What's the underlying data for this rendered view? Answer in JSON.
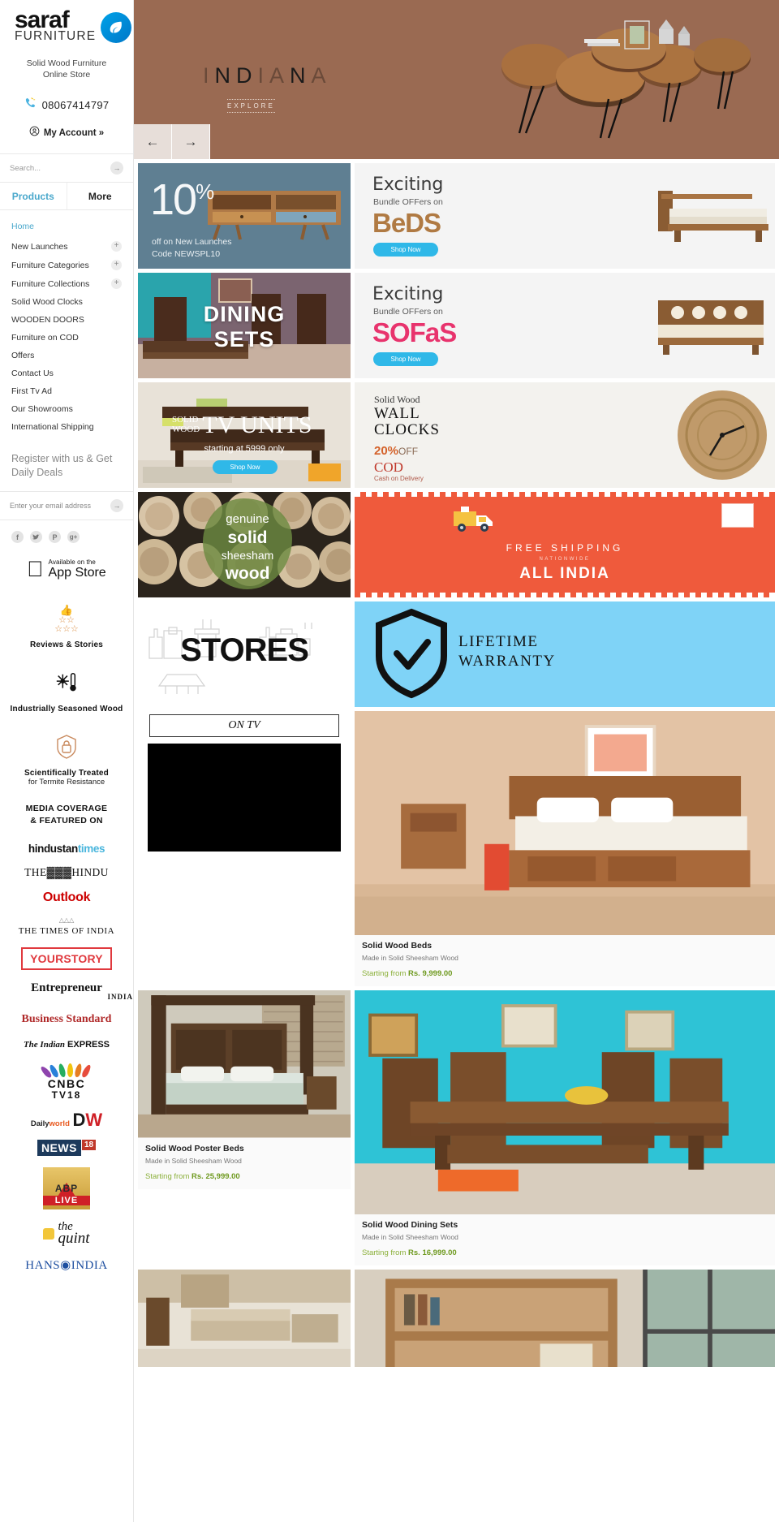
{
  "brand": {
    "name_line1": "saraf",
    "name_line2": "FURNITURE",
    "tagline_line1": "Solid Wood Furniture",
    "tagline_line2": "Online Store",
    "phone": "08067414797",
    "account_label": "My Account »"
  },
  "search": {
    "placeholder": "Search...",
    "submit_icon": "arrow-right-icon"
  },
  "tabs": [
    {
      "label": "Products",
      "active": true
    },
    {
      "label": "More",
      "active": false
    }
  ],
  "nav": [
    {
      "label": "Home",
      "expandable": false,
      "active": true
    },
    {
      "label": "New Launches",
      "expandable": true
    },
    {
      "label": "Furniture Categories",
      "expandable": true
    },
    {
      "label": "Furniture Collections",
      "expandable": true
    },
    {
      "label": "Solid Wood Clocks",
      "expandable": false
    },
    {
      "label": "WOODEN DOORS",
      "expandable": false
    },
    {
      "label": "Furniture on COD",
      "expandable": false
    },
    {
      "label": "Offers",
      "expandable": false
    },
    {
      "label": "Contact Us",
      "expandable": false
    },
    {
      "label": "First Tv Ad",
      "expandable": false
    },
    {
      "label": "Our Showrooms",
      "expandable": false
    },
    {
      "label": "International Shipping",
      "expandable": false
    }
  ],
  "newsletter": {
    "heading": "Register with us & Get Daily Deals",
    "placeholder": "Enter your email address",
    "submit_icon": "arrow-right-icon"
  },
  "social": [
    {
      "name": "facebook-icon",
      "glyph": "f"
    },
    {
      "name": "twitter-icon",
      "glyph": "✒"
    },
    {
      "name": "pinterest-icon",
      "glyph": "P"
    },
    {
      "name": "googleplus-icon",
      "glyph": "g+"
    }
  ],
  "appstore": {
    "small": "Available on the",
    "big": "App Store"
  },
  "features": [
    {
      "icon": "stars-thumbsup-icon",
      "title": "Reviews & Stories",
      "sub": ""
    },
    {
      "icon": "snowflake-thermometer-icon",
      "title": "Industrially Seasoned Wood",
      "sub": ""
    },
    {
      "icon": "shield-lock-icon",
      "title": "Scientifically Treated",
      "sub": "for Termite Resistance"
    }
  ],
  "media": {
    "heading_line1": "MEDIA COVERAGE",
    "heading_line2": "& FEATURED ON",
    "logos": [
      "hindustantimes",
      "THE HINDU",
      "Outlook",
      "THE TIMES OF INDIA",
      "YOURSTORY",
      "Entrepreneur INDIA",
      "Business Standard",
      "The Indian EXPRESS",
      "CNBC TV18",
      "Dailyworld DW",
      "NEWS 18",
      "ABP LIVE",
      "the quint",
      "THE HANS INDIA"
    ]
  },
  "hero": {
    "title": "INDIANA",
    "cta": "EXPLORE",
    "prev_icon": "arrow-left-icon",
    "next_icon": "arrow-right-icon",
    "bg_color": "#9a6a52"
  },
  "promos": [
    {
      "name": "ten-percent-off",
      "number": "10",
      "percent": "%",
      "line1": "off on New Launches",
      "line2": "Code NEWSPL10"
    },
    {
      "name": "bundle-offers-beds",
      "exciting": "Exciting",
      "bundle": "Bundle OFFers on",
      "category": "BeDS",
      "button": "Shop Now"
    },
    {
      "name": "dining-sets",
      "line1": "DINING",
      "line2": "SETS"
    },
    {
      "name": "bundle-offers-sofas",
      "exciting": "Exciting",
      "bundle": "Bundle OFFers on",
      "category": "SOFaS",
      "button": "Shop Now"
    },
    {
      "name": "tv-units",
      "solid": "SOLID",
      "wood": "WOOD",
      "tv": "TV UNITS",
      "starting": "starting at 5999 only",
      "button": "Shop Now"
    },
    {
      "name": "wall-clocks",
      "l1": "Solid Wood",
      "l2a": "WALL",
      "l2b": "CLOCKS",
      "off": "20%",
      "off_suffix": "OFF",
      "cod": "COD",
      "cod_sub": "Cash on Delivery"
    },
    {
      "name": "sheesham-wood",
      "w1": "genuine",
      "w2": "solid",
      "w3": "sheesham",
      "w4": "wood"
    },
    {
      "name": "free-shipping",
      "l1": "FREE SHIPPING",
      "l2": "NATIONWIDE",
      "l3": "ALL INDIA"
    },
    {
      "name": "stores",
      "word": "STORES"
    },
    {
      "name": "lifetime-warranty",
      "l1": "LIFETIME",
      "l2": "WARRANTY"
    }
  ],
  "ontv": {
    "label": "ON TV"
  },
  "products": [
    {
      "name": "Solid Wood Beds",
      "desc": "Made in Solid Sheesham Wood",
      "price_prefix": "Starting from",
      "price": "Rs. 9,999.00"
    },
    {
      "name": "Solid Wood Poster Beds",
      "desc": "Made in Solid Sheesham Wood",
      "price_prefix": "Starting from",
      "price": "Rs. 25,999.00"
    },
    {
      "name": "Solid Wood Dining Sets",
      "desc": "Made in Solid Sheesham Wood",
      "price_prefix": "Starting from",
      "price": "Rs. 16,999.00"
    }
  ]
}
